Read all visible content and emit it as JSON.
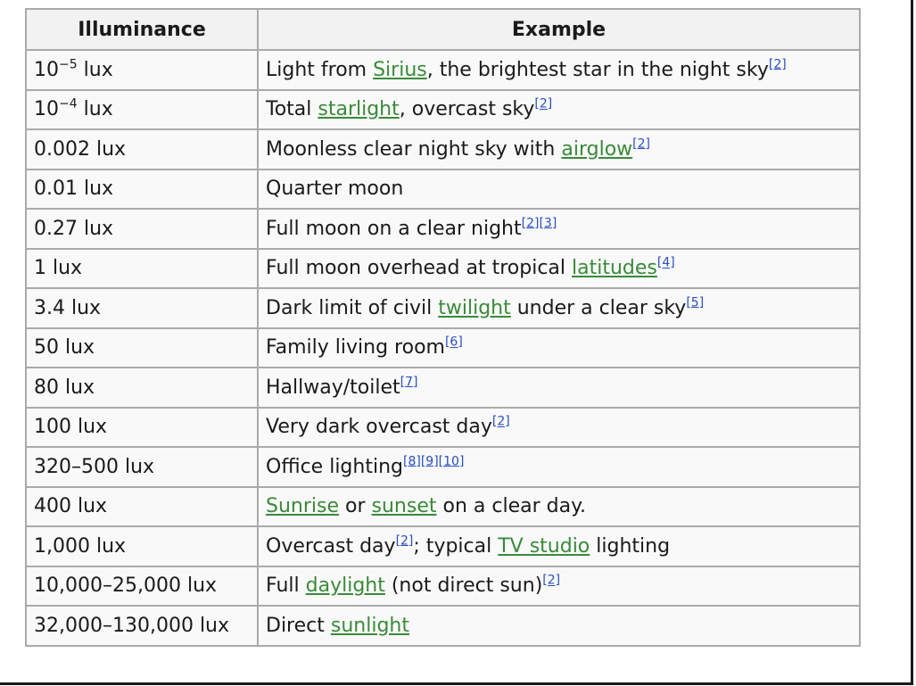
{
  "headers": {
    "illuminance": "Illuminance",
    "example": "Example"
  },
  "rows": [
    {
      "ill": [
        {
          "t": "10"
        },
        {
          "t": "−5",
          "sup": true
        },
        {
          "t": " lux"
        }
      ],
      "ex": [
        {
          "t": "Light from "
        },
        {
          "t": "Sirius",
          "link": true
        },
        {
          "t": ", the brightest star in the night sky"
        },
        {
          "t": "[2]",
          "ref": true
        }
      ]
    },
    {
      "ill": [
        {
          "t": "10"
        },
        {
          "t": "−4",
          "sup": true
        },
        {
          "t": " lux"
        }
      ],
      "ex": [
        {
          "t": "Total "
        },
        {
          "t": "starlight",
          "link": true
        },
        {
          "t": ", overcast sky"
        },
        {
          "t": "[2]",
          "ref": true
        }
      ]
    },
    {
      "ill": [
        {
          "t": "0.002 lux"
        }
      ],
      "ex": [
        {
          "t": "Moonless clear night sky with "
        },
        {
          "t": "airglow",
          "link": true
        },
        {
          "t": "[2]",
          "ref": true
        }
      ]
    },
    {
      "ill": [
        {
          "t": "0.01 lux"
        }
      ],
      "ex": [
        {
          "t": "Quarter moon"
        }
      ]
    },
    {
      "ill": [
        {
          "t": "0.27 lux"
        }
      ],
      "ex": [
        {
          "t": "Full moon on a clear night"
        },
        {
          "t": "[2][3]",
          "ref": true
        }
      ]
    },
    {
      "ill": [
        {
          "t": "1 lux"
        }
      ],
      "ex": [
        {
          "t": "Full moon overhead at tropical "
        },
        {
          "t": "latitudes",
          "link": true
        },
        {
          "t": "[4]",
          "ref": true
        }
      ]
    },
    {
      "ill": [
        {
          "t": "3.4 lux"
        }
      ],
      "ex": [
        {
          "t": "Dark limit of civil "
        },
        {
          "t": "twilight",
          "link": true
        },
        {
          "t": " under a clear sky"
        },
        {
          "t": "[5]",
          "ref": true
        }
      ]
    },
    {
      "ill": [
        {
          "t": "50 lux"
        }
      ],
      "ex": [
        {
          "t": "Family living room"
        },
        {
          "t": "[6]",
          "ref": true
        }
      ]
    },
    {
      "ill": [
        {
          "t": "80 lux"
        }
      ],
      "ex": [
        {
          "t": "Hallway/toilet"
        },
        {
          "t": "[7]",
          "ref": true
        }
      ]
    },
    {
      "ill": [
        {
          "t": "100 lux"
        }
      ],
      "ex": [
        {
          "t": "Very dark overcast day"
        },
        {
          "t": "[2]",
          "ref": true
        }
      ]
    },
    {
      "ill": [
        {
          "t": "320–500 lux"
        }
      ],
      "ex": [
        {
          "t": "Office lighting"
        },
        {
          "t": "[8][9][10]",
          "ref": true
        }
      ]
    },
    {
      "ill": [
        {
          "t": "400 lux"
        }
      ],
      "ex": [
        {
          "t": "Sunrise",
          "link": true
        },
        {
          "t": " or "
        },
        {
          "t": "sunset",
          "link": true
        },
        {
          "t": " on a clear day."
        }
      ]
    },
    {
      "ill": [
        {
          "t": "1,000 lux"
        }
      ],
      "ex": [
        {
          "t": "Overcast day"
        },
        {
          "t": "[2]",
          "ref": true
        },
        {
          "t": "; typical "
        },
        {
          "t": "TV studio",
          "link": true
        },
        {
          "t": " lighting"
        }
      ]
    },
    {
      "ill": [
        {
          "t": "10,000–25,000 lux"
        }
      ],
      "ex": [
        {
          "t": "Full "
        },
        {
          "t": "daylight",
          "link": true
        },
        {
          "t": " (not direct sun)"
        },
        {
          "t": "[2]",
          "ref": true
        }
      ]
    },
    {
      "ill": [
        {
          "t": "32,000–130,000 lux"
        }
      ],
      "ex": [
        {
          "t": "Direct "
        },
        {
          "t": "sunlight",
          "link": true
        }
      ]
    }
  ],
  "colors": {
    "link": "#3a8a3a",
    "ref": "#2a4fbf",
    "border": "#aaaaaa",
    "header_bg": "#f2f2f2",
    "cell_bg": "#f9f9f9"
  }
}
